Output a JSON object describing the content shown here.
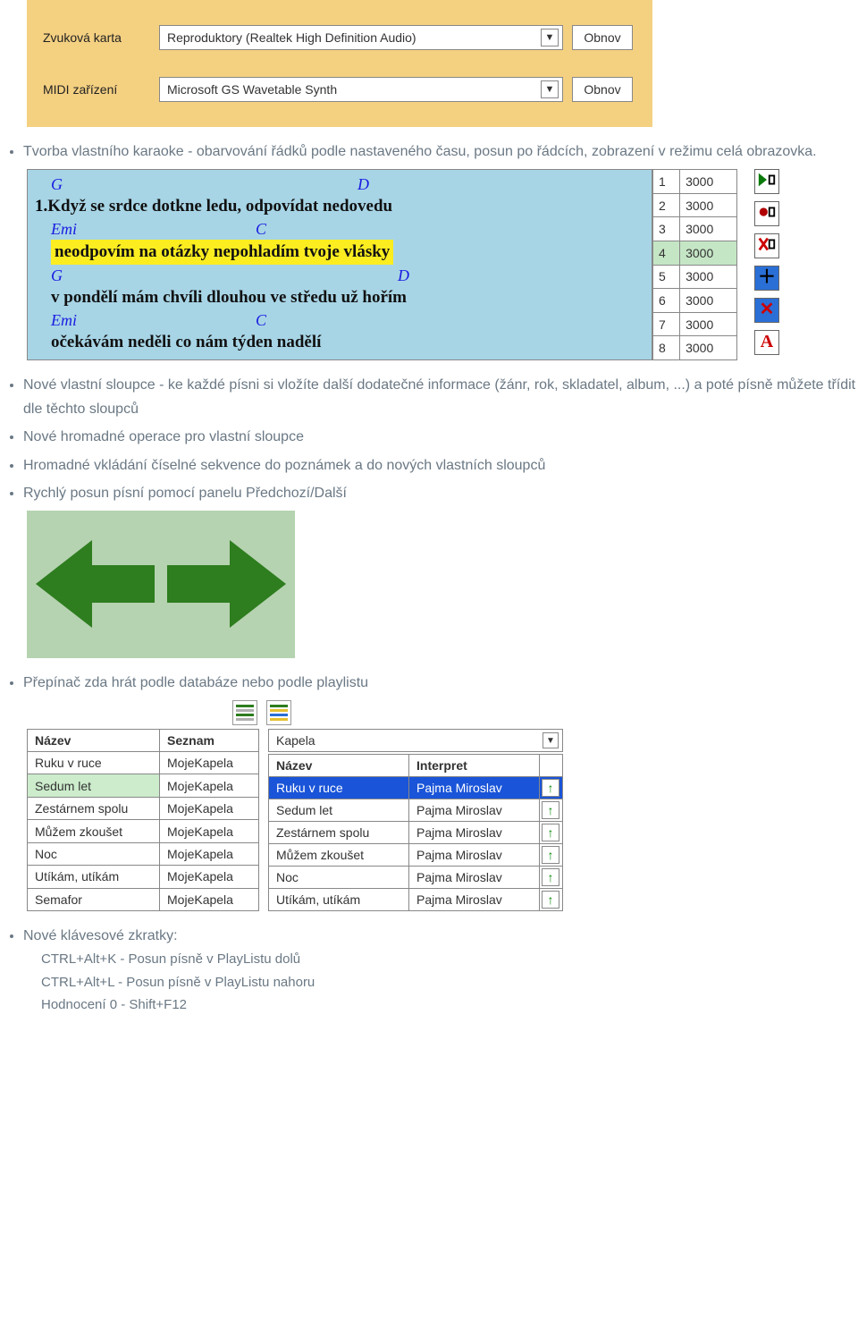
{
  "audio": {
    "sound_card_label": "Zvuková karta",
    "sound_card_value": "Reproduktory (Realtek High Definition Audio)",
    "midi_label": "MIDI zařízení",
    "midi_value": "Microsoft GS Wavetable Synth",
    "refresh_label": "Obnov"
  },
  "bullets": {
    "b1": "Tvorba vlastního karaoke - obarvování řádků podle nastaveného času, posun po řádcích, zobrazení v režimu celá obrazovka.",
    "b2": "Nové vlastní sloupce - ke každé písni si vložíte další dodatečné informace (žánr, rok, skladatel, album, ...) a poté písně můžete třídit dle těchto sloupců",
    "b3": "Nové hromadné operace pro vlastní sloupce",
    "b4": "Hromadné vkládání číselné sekvence do poznámek a do nových vlastních sloupců",
    "b5": "Rychlý posun písní pomocí panelu Předchozí/Další",
    "b6": "Přepínač zda hrát podle databáze nebo podle playlistu",
    "b7": "Nové klávesové zkratky:",
    "b7a": "CTRL+Alt+K - Posun písně v PlayListu dolů",
    "b7b": "CTRL+Alt+L - Posun písně v PlayListu nahoru",
    "b7c": "Hodnocení 0 - Shift+F12"
  },
  "lyrics": {
    "chord1a": "G",
    "chord1b": "D",
    "line1_num": "1.",
    "line1": "Když se srdce dotkne ledu, odpovídat nedovedu",
    "chord2a": "Emi",
    "chord2b": "C",
    "line2": "neodpovím na otázky nepohladím tvoje vlásky",
    "chord3a": "G",
    "chord3b": "D",
    "line3": "v pondělí mám chvíli dlouhou ve středu už hořím",
    "chord4a": "Emi",
    "chord4b": "C",
    "line4": "očekávám neděli co nám týden nadělí"
  },
  "timing": [
    {
      "n": "1",
      "v": "3000"
    },
    {
      "n": "2",
      "v": "3000"
    },
    {
      "n": "3",
      "v": "3000"
    },
    {
      "n": "4",
      "v": "3000",
      "sel": true
    },
    {
      "n": "5",
      "v": "3000"
    },
    {
      "n": "6",
      "v": "3000"
    },
    {
      "n": "7",
      "v": "3000"
    },
    {
      "n": "8",
      "v": "3000"
    }
  ],
  "songs": {
    "header_name": "Název",
    "header_list": "Seznam",
    "rows": [
      {
        "name": "Ruku v ruce",
        "list": "MojeKapela"
      },
      {
        "name": "Sedum let",
        "list": "MojeKapela",
        "sel": true
      },
      {
        "name": "Zestárnem spolu",
        "list": "MojeKapela"
      },
      {
        "name": "Můžem zkoušet",
        "list": "MojeKapela"
      },
      {
        "name": "Noc",
        "list": "MojeKapela"
      },
      {
        "name": "Utíkám, utíkám",
        "list": "MojeKapela"
      },
      {
        "name": "Semafor",
        "list": "MojeKapela"
      }
    ]
  },
  "playlist": {
    "band_value": "Kapela",
    "header_name": "Název",
    "header_interpret": "Interpret",
    "rows": [
      {
        "name": "Ruku v ruce",
        "interpret": "Pajma Miroslav",
        "sel": true
      },
      {
        "name": "Sedum let",
        "interpret": "Pajma Miroslav"
      },
      {
        "name": "Zestárnem spolu",
        "interpret": "Pajma Miroslav"
      },
      {
        "name": "Můžem zkoušet",
        "interpret": "Pajma Miroslav"
      },
      {
        "name": "Noc",
        "interpret": "Pajma Miroslav"
      },
      {
        "name": "Utíkám, utíkám",
        "interpret": "Pajma Miroslav"
      }
    ]
  }
}
